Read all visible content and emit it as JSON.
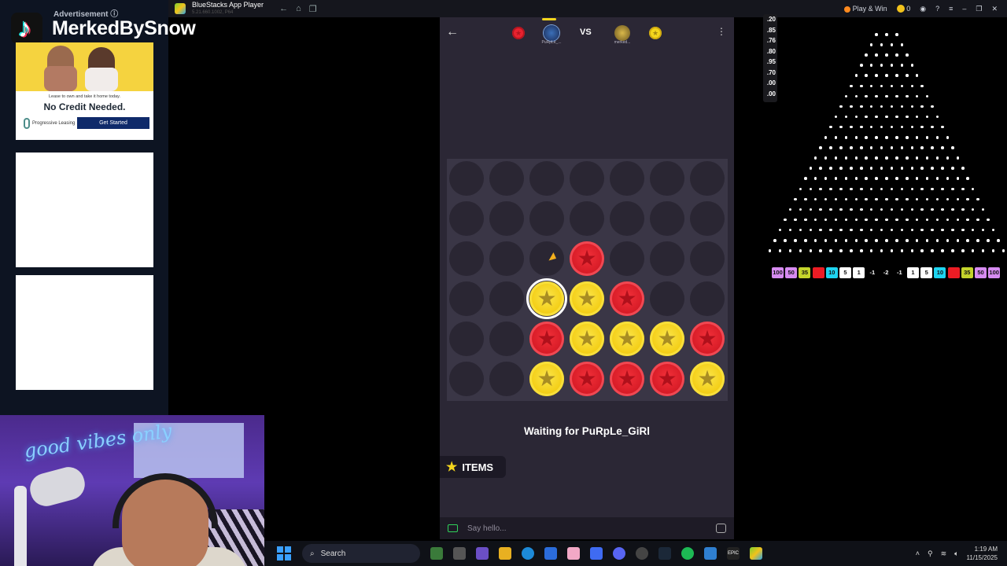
{
  "overlay": {
    "channel_name": "MerkedBySnow"
  },
  "ads": {
    "label": "Advertisement ⓘ",
    "card": {
      "small_text": "Lease to own and take it home today.",
      "headline": "No Credit Needed.",
      "brand": "Progressive Leasing",
      "cta": "Get Started"
    }
  },
  "webcam": {
    "neon_text": "good vibes only"
  },
  "bluestacks": {
    "title": "BlueStacks App Player",
    "version": "5.21.660.1002, P64",
    "play_win": "Play & Win",
    "coins": "0"
  },
  "game": {
    "vs": "VS",
    "player1_name": "PuRpLe_...",
    "player2_name": "merked...",
    "status": "Waiting for PuRpLe_GiRl",
    "items_label": "ITEMS",
    "chat_placeholder": "Say hello...",
    "board": [
      [
        "",
        "",
        "",
        "",
        "",
        "",
        ""
      ],
      [
        "",
        "",
        "",
        "",
        "",
        "",
        ""
      ],
      [
        "",
        "",
        "",
        "R",
        "",
        "",
        ""
      ],
      [
        "",
        "",
        "Y",
        "Y",
        "R",
        "",
        ""
      ],
      [
        "",
        "",
        "R",
        "Y",
        "Y",
        "Y",
        "R"
      ],
      [
        "",
        "",
        "Y",
        "R",
        "R",
        "R",
        "Y"
      ]
    ],
    "last_move": {
      "row": 3,
      "col": 2
    },
    "colors": {
      "red": "#e8222f",
      "yellow": "#f4d61d"
    }
  },
  "plinko": {
    "multipliers": [
      ".20",
      ".85",
      ".76",
      ".80",
      ".95",
      ".70",
      ".00",
      ".00"
    ],
    "buckets": [
      {
        "label": "100",
        "color": "#d68bf0"
      },
      {
        "label": "50",
        "color": "#d68bf0"
      },
      {
        "label": "35",
        "color": "#c4d42b"
      },
      {
        "label": "",
        "color": "#ec1c24"
      },
      {
        "label": "10",
        "color": "#1ed4f0"
      },
      {
        "label": "5",
        "color": "#ffffff"
      },
      {
        "label": "1",
        "color": "#ffffff"
      },
      {
        "label": "-1",
        "color": "transparent"
      },
      {
        "label": "-2",
        "color": "transparent"
      },
      {
        "label": "-1",
        "color": "transparent"
      },
      {
        "label": "1",
        "color": "#ffffff"
      },
      {
        "label": "5",
        "color": "#ffffff"
      },
      {
        "label": "10",
        "color": "#1ed4f0"
      },
      {
        "label": "",
        "color": "#ec1c24"
      },
      {
        "label": "35",
        "color": "#c4d42b"
      },
      {
        "label": "50",
        "color": "#d68bf0"
      },
      {
        "label": "100",
        "color": "#d68bf0"
      }
    ]
  },
  "taskbar": {
    "search_placeholder": "Search",
    "time": "1:19 AM",
    "date": "11/15/2025"
  }
}
